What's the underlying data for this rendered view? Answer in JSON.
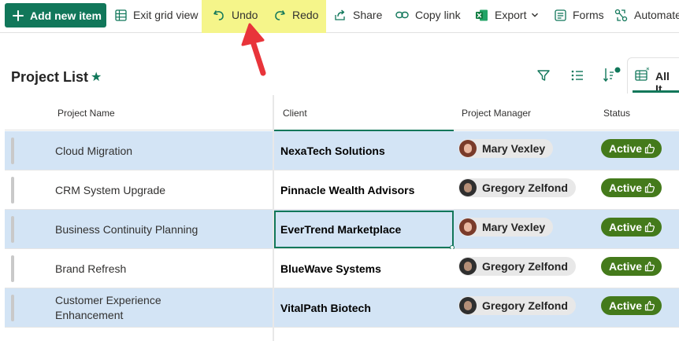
{
  "toolbar": {
    "add_label": "Add new item",
    "exit_grid_label": "Exit grid view",
    "undo_label": "Undo",
    "redo_label": "Redo",
    "share_label": "Share",
    "copy_link_label": "Copy link",
    "export_label": "Export",
    "forms_label": "Forms",
    "automate_label": "Automate",
    "highlight_color": "#f5f58a",
    "accent_color": "#11775a"
  },
  "list": {
    "title": "Project List",
    "favorite_icon": "star-icon",
    "view_label": "All It"
  },
  "columns": [
    "Project Name",
    "Client",
    "Project Manager",
    "Status"
  ],
  "rows": [
    {
      "project": "Cloud Migration",
      "client": "NexaTech Solutions",
      "manager": "Mary Vexley",
      "status": "Active",
      "selected": true
    },
    {
      "project": "CRM System Upgrade",
      "client": "Pinnacle Wealth Advisors",
      "manager": "Gregory Zelfond",
      "status": "Active",
      "selected": false
    },
    {
      "project": "Business Continuity Planning",
      "client": "EverTrend Marketplace",
      "manager": "Mary Vexley",
      "status": "Active",
      "selected": true
    },
    {
      "project": "Brand Refresh",
      "client": "BlueWave Systems",
      "manager": "Gregory Zelfond",
      "status": "Active",
      "selected": false
    },
    {
      "project": "Customer Experience Enhancement",
      "client": "VitalPath Biotech",
      "manager": "Gregory Zelfond",
      "status": "Active",
      "selected": true
    }
  ],
  "status_color": "#447a1b",
  "selected_row_color": "#d3e4f5"
}
